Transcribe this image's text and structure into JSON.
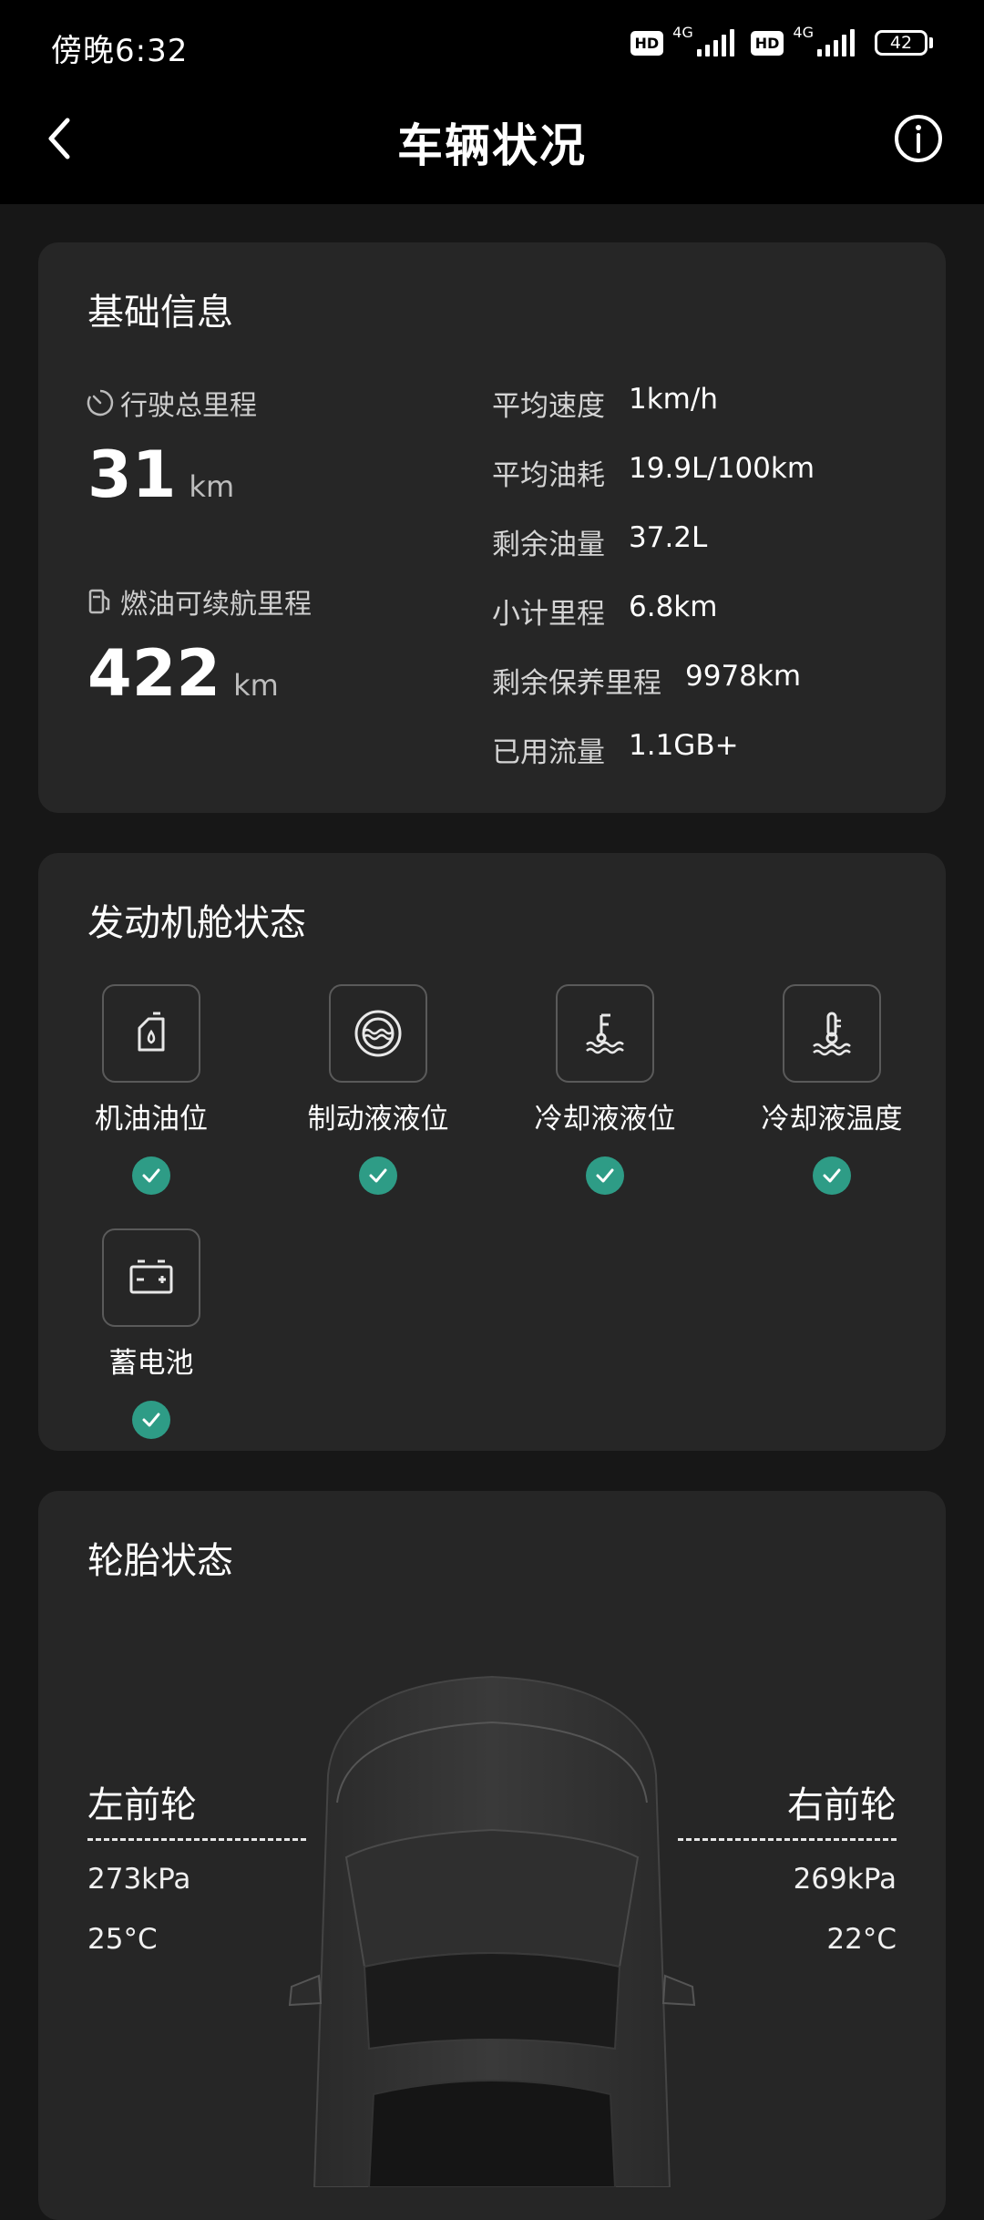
{
  "status": {
    "time": "傍晚6:32",
    "hd": "HD",
    "net": "4G",
    "battery": "42"
  },
  "header": {
    "title": "车辆状况"
  },
  "basic": {
    "title": "基础信息",
    "mileage": {
      "label": "行驶总里程",
      "value": "31",
      "unit": "km"
    },
    "range": {
      "label": "燃油可续航里程",
      "value": "422",
      "unit": "km"
    },
    "stats": [
      {
        "label": "平均速度",
        "value": "1km/h"
      },
      {
        "label": "平均油耗",
        "value": "19.9L/100km"
      },
      {
        "label": "剩余油量",
        "value": "37.2L"
      },
      {
        "label": "小计里程",
        "value": "6.8km"
      },
      {
        "label": "剩余保养里程",
        "value": "9978km"
      },
      {
        "label": "已用流量",
        "value": "1.1GB+"
      }
    ]
  },
  "engine": {
    "title": "发动机舱状态",
    "items": [
      {
        "label": "机油油位",
        "icon": "oil-can-icon",
        "status": "ok"
      },
      {
        "label": "制动液液位",
        "icon": "brake-fluid-icon",
        "status": "ok"
      },
      {
        "label": "冷却液液位",
        "icon": "coolant-level-icon",
        "status": "ok"
      },
      {
        "label": "冷却液温度",
        "icon": "coolant-temp-icon",
        "status": "ok"
      },
      {
        "label": "蓄电池",
        "icon": "battery-icon",
        "status": "ok"
      }
    ]
  },
  "tires": {
    "title": "轮胎状态",
    "front_left": {
      "label": "左前轮",
      "pressure": "273kPa",
      "temp": "25°C"
    },
    "front_right": {
      "label": "右前轮",
      "pressure": "269kPa",
      "temp": "22°C"
    }
  },
  "colors": {
    "ok": "#2e9c86",
    "card": "#262626",
    "bg": "#171717"
  }
}
